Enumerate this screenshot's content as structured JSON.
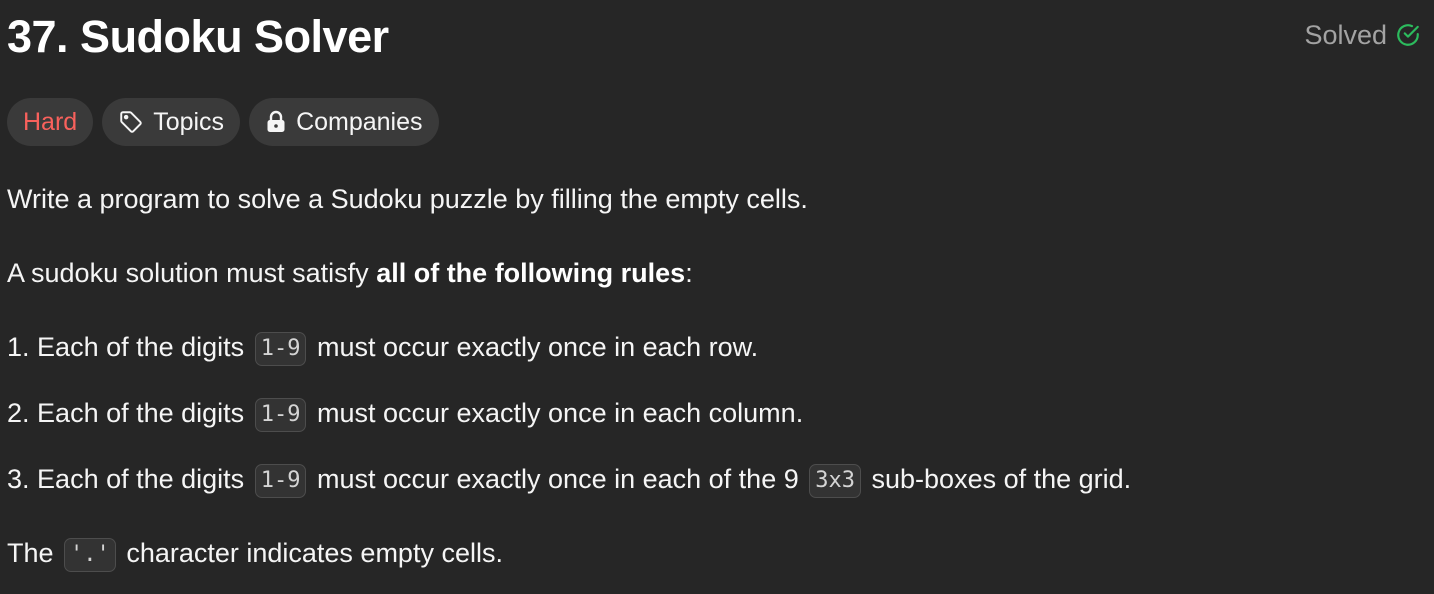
{
  "problem": {
    "title": "37. Sudoku Solver",
    "status_label": "Solved",
    "status_color": "#2cbb5d",
    "status_icon": "check-circle-icon"
  },
  "tags": {
    "difficulty": "Hard",
    "difficulty_color": "#f8615c",
    "topics_label": "Topics",
    "topics_icon": "tag-icon",
    "companies_label": "Companies",
    "companies_icon": "lock-icon"
  },
  "description": {
    "intro": "Write a program to solve a Sudoku puzzle by filling the empty cells.",
    "rules_intro_prefix": "A sudoku solution must satisfy ",
    "rules_intro_bold": "all of the following rules",
    "rules_intro_suffix": ":",
    "rules": [
      {
        "number": "1.",
        "before": "Each of the digits",
        "code": "1-9",
        "after": "must occur exactly once in each row."
      },
      {
        "number": "2.",
        "before": "Each of the digits",
        "code": "1-9",
        "after": "must occur exactly once in each column."
      },
      {
        "number": "3.",
        "before": "Each of the digits",
        "code": "1-9",
        "middle": "must occur exactly once in each of the 9",
        "code2": "3x3",
        "after": "sub-boxes of the grid."
      }
    ],
    "empty_prefix": "The",
    "empty_code": "'.'",
    "empty_suffix": "character indicates empty cells."
  }
}
